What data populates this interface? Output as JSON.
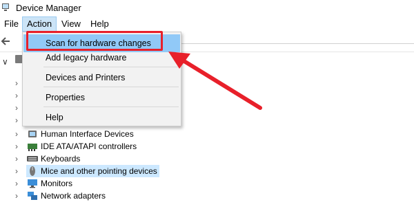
{
  "window": {
    "title": "Device Manager"
  },
  "menubar": {
    "items": [
      {
        "label": "File"
      },
      {
        "label": "Action"
      },
      {
        "label": "View"
      },
      {
        "label": "Help"
      }
    ]
  },
  "action_menu": {
    "items": [
      {
        "label": "Scan for hardware changes"
      },
      {
        "label": "Add legacy hardware"
      },
      {
        "label": "Devices and Printers"
      },
      {
        "label": "Properties"
      },
      {
        "label": "Help"
      }
    ]
  },
  "tree": {
    "visible_devices": [
      {
        "label": "Human Interface Devices",
        "icon": "hid-icon"
      },
      {
        "label": "IDE ATA/ATAPI controllers",
        "icon": "ide-controller-icon"
      },
      {
        "label": "Keyboards",
        "icon": "keyboard-icon"
      },
      {
        "label": "Mice and other pointing devices",
        "icon": "mouse-icon"
      },
      {
        "label": "Monitors",
        "icon": "monitor-icon"
      },
      {
        "label": "Network adapters",
        "icon": "network-adapter-icon"
      }
    ]
  },
  "colors": {
    "highlight": "#91c9f7",
    "annotation_red": "#e8202a",
    "selected_row": "#cce8ff"
  }
}
